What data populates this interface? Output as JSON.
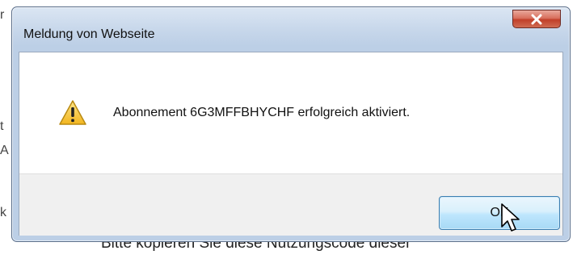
{
  "dialog": {
    "title": "Meldung von Webseite",
    "message": "Abonnement 6G3MFFBHYCHF erfolgreich aktiviert.",
    "ok_label": "OK",
    "icons": {
      "close": "close-icon",
      "warning": "warning-icon",
      "cursor": "mouse-cursor-icon"
    }
  },
  "background_page": {
    "partial_text": "Bitte kopieren Sie diese Nutzungscode dieser"
  },
  "colors": {
    "close_button": "#c13f2a",
    "ok_button_border": "#3c7fb1",
    "warning_yellow": "#f7c948"
  }
}
